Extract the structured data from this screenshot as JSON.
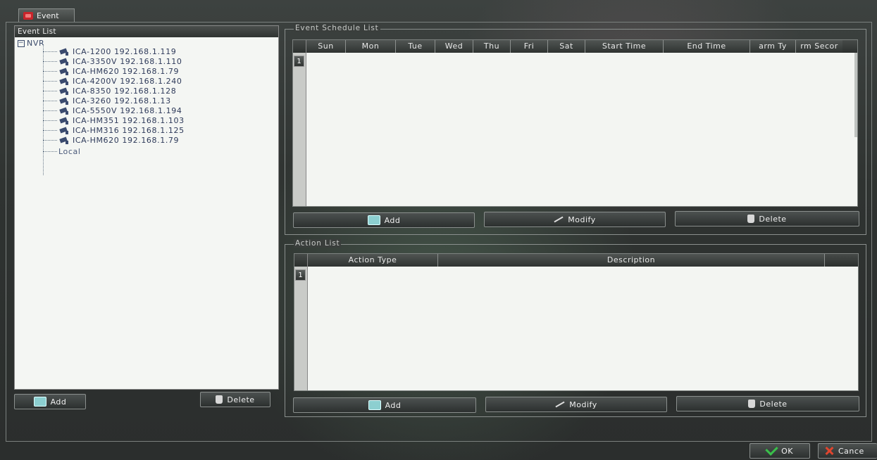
{
  "tab": {
    "label": "Event"
  },
  "event_list": {
    "header": "Event List",
    "root": "NVR",
    "devices": [
      {
        "label": "ICA-1200 192.168.1.119"
      },
      {
        "label": "ICA-3350V 192.168.1.110"
      },
      {
        "label": "ICA-HM620 192.168.1.79"
      },
      {
        "label": "ICA-4200V 192.168.1.240"
      },
      {
        "label": "ICA-8350 192.168.1.128"
      },
      {
        "label": "ICA-3260 192.168.1.13"
      },
      {
        "label": "ICA-5550V 192.168.1.194"
      },
      {
        "label": "ICA-HM351 192.168.1.103"
      },
      {
        "label": "ICA-HM316 192.168.1.125"
      },
      {
        "label": "ICA-HM620 192.168.1.79"
      }
    ],
    "local": "Local",
    "add_label": "Add",
    "delete_label": "Delete"
  },
  "schedule": {
    "title": "Event Schedule List",
    "columns": [
      "Sun",
      "Mon",
      "Tue",
      "Wed",
      "Thu",
      "Fri",
      "Sat",
      "Start Time",
      "End Time",
      "arm Ty",
      "rm Secor"
    ],
    "row_number": "1",
    "add_label": "Add",
    "modify_label": "Modify",
    "delete_label": "Delete"
  },
  "action": {
    "title": "Action List",
    "columns": [
      "Action Type",
      "Description"
    ],
    "row_number": "1",
    "add_label": "Add",
    "modify_label": "Modify",
    "delete_label": "Delete"
  },
  "footer": {
    "ok_label": "OK",
    "cancel_label": "Cance"
  }
}
